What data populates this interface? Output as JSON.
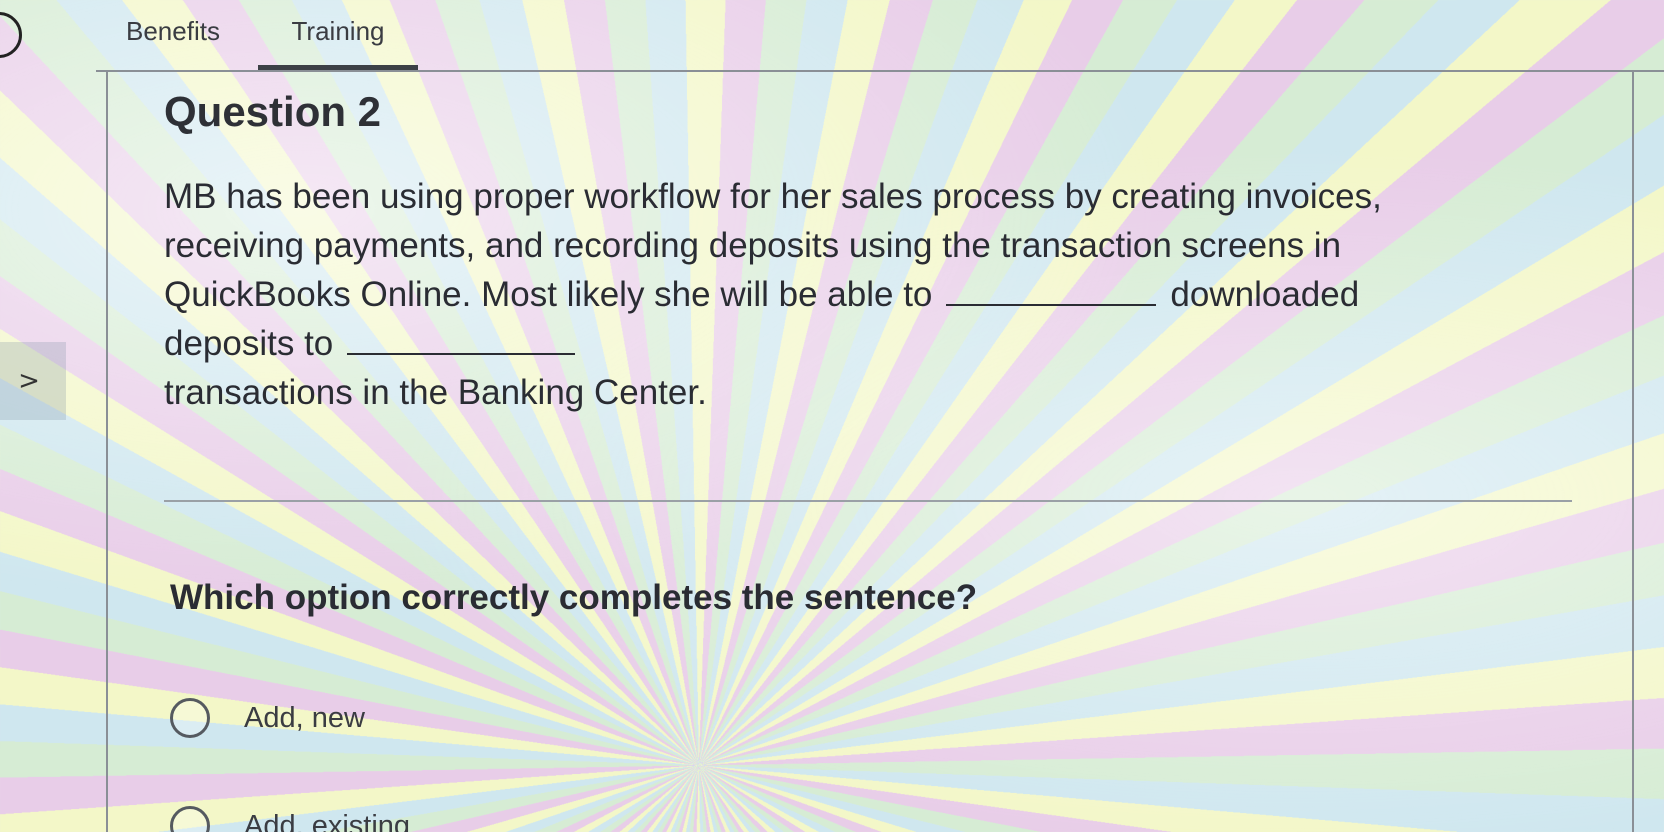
{
  "tabs": {
    "benefits": "Benefits",
    "training": "Training"
  },
  "side_panel": {
    "chevron": ">"
  },
  "question": {
    "title": "Question 2",
    "body_part1": "MB has been using proper workflow for her sales process by creating invoices, receiving payments, and recording deposits using the transaction screens in QuickBooks Online. Most likely she will be able to",
    "body_part2": "downloaded deposits to",
    "body_part3": "transactions in the Banking Center.",
    "prompt": "Which option correctly completes the sentence?"
  },
  "options": [
    {
      "label": "Add, new"
    },
    {
      "label": "Add, existing"
    }
  ]
}
